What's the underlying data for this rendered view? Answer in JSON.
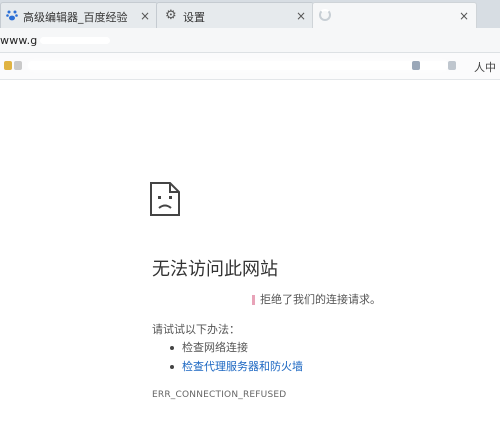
{
  "tabs": [
    {
      "label": "高级编辑器_百度经验",
      "icon": "baidu-paw-icon"
    },
    {
      "label": "设置",
      "icon": "gear-icon"
    },
    {
      "label": "",
      "icon": "loading-spinner-icon"
    }
  ],
  "tab_close_glyph": "×",
  "address": {
    "url": "www.g"
  },
  "bookmarks": {
    "right_text": "人中"
  },
  "error": {
    "title": "无法访问此网站",
    "subtitle": "拒绝了我们的连接请求。",
    "try_label": "请试试以下办法：",
    "suggestions": [
      "检查网络连接",
      "检查代理服务器和防火墙"
    ],
    "code": "ERR_CONNECTION_REFUSED"
  },
  "colors": {
    "link": "#1a66c2",
    "title": "#333333",
    "tab_strip": "#d7dde3"
  }
}
